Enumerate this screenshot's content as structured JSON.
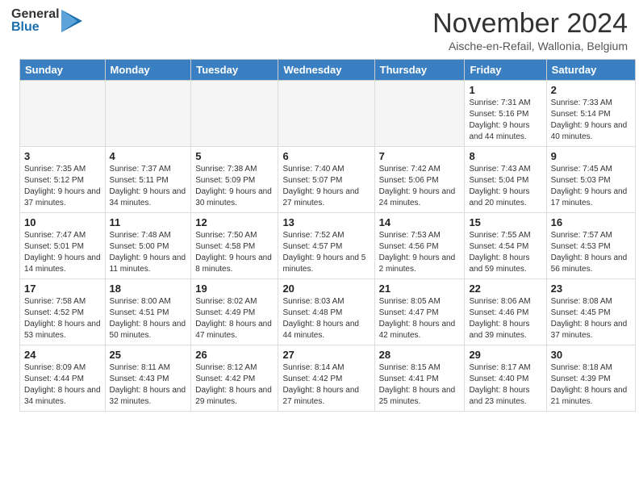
{
  "header": {
    "logo_general": "General",
    "logo_blue": "Blue",
    "title": "November 2024",
    "location": "Aische-en-Refail, Wallonia, Belgium"
  },
  "days_of_week": [
    "Sunday",
    "Monday",
    "Tuesday",
    "Wednesday",
    "Thursday",
    "Friday",
    "Saturday"
  ],
  "weeks": [
    [
      {
        "day": "",
        "empty": true
      },
      {
        "day": "",
        "empty": true
      },
      {
        "day": "",
        "empty": true
      },
      {
        "day": "",
        "empty": true
      },
      {
        "day": "",
        "empty": true
      },
      {
        "day": "1",
        "sunrise": "Sunrise: 7:31 AM",
        "sunset": "Sunset: 5:16 PM",
        "daylight": "Daylight: 9 hours and 44 minutes."
      },
      {
        "day": "2",
        "sunrise": "Sunrise: 7:33 AM",
        "sunset": "Sunset: 5:14 PM",
        "daylight": "Daylight: 9 hours and 40 minutes."
      }
    ],
    [
      {
        "day": "3",
        "sunrise": "Sunrise: 7:35 AM",
        "sunset": "Sunset: 5:12 PM",
        "daylight": "Daylight: 9 hours and 37 minutes."
      },
      {
        "day": "4",
        "sunrise": "Sunrise: 7:37 AM",
        "sunset": "Sunset: 5:11 PM",
        "daylight": "Daylight: 9 hours and 34 minutes."
      },
      {
        "day": "5",
        "sunrise": "Sunrise: 7:38 AM",
        "sunset": "Sunset: 5:09 PM",
        "daylight": "Daylight: 9 hours and 30 minutes."
      },
      {
        "day": "6",
        "sunrise": "Sunrise: 7:40 AM",
        "sunset": "Sunset: 5:07 PM",
        "daylight": "Daylight: 9 hours and 27 minutes."
      },
      {
        "day": "7",
        "sunrise": "Sunrise: 7:42 AM",
        "sunset": "Sunset: 5:06 PM",
        "daylight": "Daylight: 9 hours and 24 minutes."
      },
      {
        "day": "8",
        "sunrise": "Sunrise: 7:43 AM",
        "sunset": "Sunset: 5:04 PM",
        "daylight": "Daylight: 9 hours and 20 minutes."
      },
      {
        "day": "9",
        "sunrise": "Sunrise: 7:45 AM",
        "sunset": "Sunset: 5:03 PM",
        "daylight": "Daylight: 9 hours and 17 minutes."
      }
    ],
    [
      {
        "day": "10",
        "sunrise": "Sunrise: 7:47 AM",
        "sunset": "Sunset: 5:01 PM",
        "daylight": "Daylight: 9 hours and 14 minutes."
      },
      {
        "day": "11",
        "sunrise": "Sunrise: 7:48 AM",
        "sunset": "Sunset: 5:00 PM",
        "daylight": "Daylight: 9 hours and 11 minutes."
      },
      {
        "day": "12",
        "sunrise": "Sunrise: 7:50 AM",
        "sunset": "Sunset: 4:58 PM",
        "daylight": "Daylight: 9 hours and 8 minutes."
      },
      {
        "day": "13",
        "sunrise": "Sunrise: 7:52 AM",
        "sunset": "Sunset: 4:57 PM",
        "daylight": "Daylight: 9 hours and 5 minutes."
      },
      {
        "day": "14",
        "sunrise": "Sunrise: 7:53 AM",
        "sunset": "Sunset: 4:56 PM",
        "daylight": "Daylight: 9 hours and 2 minutes."
      },
      {
        "day": "15",
        "sunrise": "Sunrise: 7:55 AM",
        "sunset": "Sunset: 4:54 PM",
        "daylight": "Daylight: 8 hours and 59 minutes."
      },
      {
        "day": "16",
        "sunrise": "Sunrise: 7:57 AM",
        "sunset": "Sunset: 4:53 PM",
        "daylight": "Daylight: 8 hours and 56 minutes."
      }
    ],
    [
      {
        "day": "17",
        "sunrise": "Sunrise: 7:58 AM",
        "sunset": "Sunset: 4:52 PM",
        "daylight": "Daylight: 8 hours and 53 minutes."
      },
      {
        "day": "18",
        "sunrise": "Sunrise: 8:00 AM",
        "sunset": "Sunset: 4:51 PM",
        "daylight": "Daylight: 8 hours and 50 minutes."
      },
      {
        "day": "19",
        "sunrise": "Sunrise: 8:02 AM",
        "sunset": "Sunset: 4:49 PM",
        "daylight": "Daylight: 8 hours and 47 minutes."
      },
      {
        "day": "20",
        "sunrise": "Sunrise: 8:03 AM",
        "sunset": "Sunset: 4:48 PM",
        "daylight": "Daylight: 8 hours and 44 minutes."
      },
      {
        "day": "21",
        "sunrise": "Sunrise: 8:05 AM",
        "sunset": "Sunset: 4:47 PM",
        "daylight": "Daylight: 8 hours and 42 minutes."
      },
      {
        "day": "22",
        "sunrise": "Sunrise: 8:06 AM",
        "sunset": "Sunset: 4:46 PM",
        "daylight": "Daylight: 8 hours and 39 minutes."
      },
      {
        "day": "23",
        "sunrise": "Sunrise: 8:08 AM",
        "sunset": "Sunset: 4:45 PM",
        "daylight": "Daylight: 8 hours and 37 minutes."
      }
    ],
    [
      {
        "day": "24",
        "sunrise": "Sunrise: 8:09 AM",
        "sunset": "Sunset: 4:44 PM",
        "daylight": "Daylight: 8 hours and 34 minutes."
      },
      {
        "day": "25",
        "sunrise": "Sunrise: 8:11 AM",
        "sunset": "Sunset: 4:43 PM",
        "daylight": "Daylight: 8 hours and 32 minutes."
      },
      {
        "day": "26",
        "sunrise": "Sunrise: 8:12 AM",
        "sunset": "Sunset: 4:42 PM",
        "daylight": "Daylight: 8 hours and 29 minutes."
      },
      {
        "day": "27",
        "sunrise": "Sunrise: 8:14 AM",
        "sunset": "Sunset: 4:42 PM",
        "daylight": "Daylight: 8 hours and 27 minutes."
      },
      {
        "day": "28",
        "sunrise": "Sunrise: 8:15 AM",
        "sunset": "Sunset: 4:41 PM",
        "daylight": "Daylight: 8 hours and 25 minutes."
      },
      {
        "day": "29",
        "sunrise": "Sunrise: 8:17 AM",
        "sunset": "Sunset: 4:40 PM",
        "daylight": "Daylight: 8 hours and 23 minutes."
      },
      {
        "day": "30",
        "sunrise": "Sunrise: 8:18 AM",
        "sunset": "Sunset: 4:39 PM",
        "daylight": "Daylight: 8 hours and 21 minutes."
      }
    ]
  ]
}
